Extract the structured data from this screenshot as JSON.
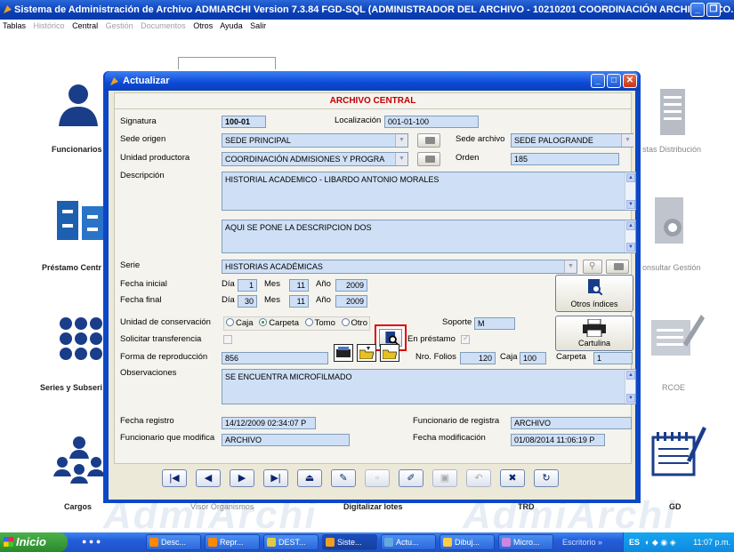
{
  "window": {
    "title": "Sistema de Administración de Archivo ADMIARCHI Version 7.3.84 FGD-SQL (ADMINISTRADOR DEL ARCHIVO - 10210201 COORDINACIÓN ARCHIVO Y CO...",
    "min": "_",
    "max": "❐"
  },
  "menu": [
    "Tablas",
    "Histórico",
    "Central",
    "Gestión",
    "Documentos",
    "Otros",
    "Ayuda",
    "Salir"
  ],
  "desktop": {
    "left_labels": [
      "Funcionarios",
      "Préstamo Centr",
      "Series y Subseri",
      "Cargos"
    ],
    "right_labels": [
      "stas Distribución",
      "onsultar Gestión",
      "RCOE",
      "GD"
    ],
    "bottom_labels": [
      "Visor Organismos",
      "Digitalizar lotes",
      "TRD"
    ],
    "watermark": "AdmiArchi"
  },
  "dialog": {
    "title": "Actualizar",
    "min": "_",
    "max": "□",
    "close": "✕",
    "header": "ARCHIVO CENTRAL",
    "signatura_label": "Signatura",
    "signatura": "100-01",
    "localizacion_label": "Localización",
    "localizacion": "001-01-100",
    "sede_origen_label": "Sede origen",
    "sede_origen": "SEDE PRINCIPAL",
    "sede_archivo_label": "Sede archivo",
    "sede_archivo": "SEDE PALOGRANDE",
    "unidad_label": "Unidad productora",
    "unidad": "COORDINACIÓN ADMISIONES Y PROGRA",
    "orden_label": "Orden",
    "orden": "185",
    "descripcion_label": "Descripción",
    "descripcion1": "HISTORIAL ACADEMICO - LIBARDO ANTONIO MORALES",
    "descripcion2": "AQUI SE PONE LA DESCRIPCION DOS",
    "serie_label": "Serie",
    "serie": "HISTORIAS ACADÉMICAS",
    "fecha_inicial_label": "Fecha inicial",
    "fecha_final_label": "Fecha final",
    "dia_label": "Día",
    "mes_label": "Mes",
    "anio_label": "Año",
    "fi_dia": "1",
    "fi_mes": "11",
    "fi_anio": "2009",
    "ff_dia": "30",
    "ff_mes": "11",
    "ff_anio": "2009",
    "otros_indices": "Otros índices",
    "conservacion_label": "Unidad de conservación",
    "conservacion_options": [
      "Caja",
      "Carpeta",
      "Tomo",
      "Otro"
    ],
    "soporte_label": "Soporte",
    "soporte": "M",
    "transferencia_label": "Solicitar transferencia",
    "prestamo_label": "En préstamo",
    "cartulina": "Cartulina",
    "reproduccion_label": "Forma de reproducción",
    "reproduccion": "856",
    "folios_label": "Nro. Folios",
    "folios": "120",
    "caja_label": "Caja",
    "caja": "100",
    "carpeta_label": "Carpeta",
    "carpeta": "1",
    "observaciones_label": "Observaciones",
    "observaciones": "SE ENCUENTRA MICROFILMADO",
    "fecha_registro_label": "Fecha registro",
    "fecha_registro": "14/12/2009 02:34:07 P",
    "func_registra_label": "Funcionario de registra",
    "func_registra": "ARCHIVO",
    "func_modifica_label": "Funcionario que modifica",
    "func_modifica": "ARCHIVO",
    "fecha_mod_label": "Fecha modificación",
    "fecha_mod": "01/08/2014 11:06:19 P"
  },
  "taskbar": {
    "start": "Inicio",
    "items": [
      "Desc...",
      "Repr...",
      "DEST...",
      "Siste...",
      "Actu...",
      "Dibuj...",
      "Micro..."
    ],
    "escritorio": "Escritorio",
    "lang": "ES",
    "clock": "11:07 p.m."
  },
  "colors": {
    "titlebar": "#0a3fb6",
    "field_bg": "#cfe0f6",
    "header_red": "#c00000",
    "highlight": "#e00000"
  }
}
